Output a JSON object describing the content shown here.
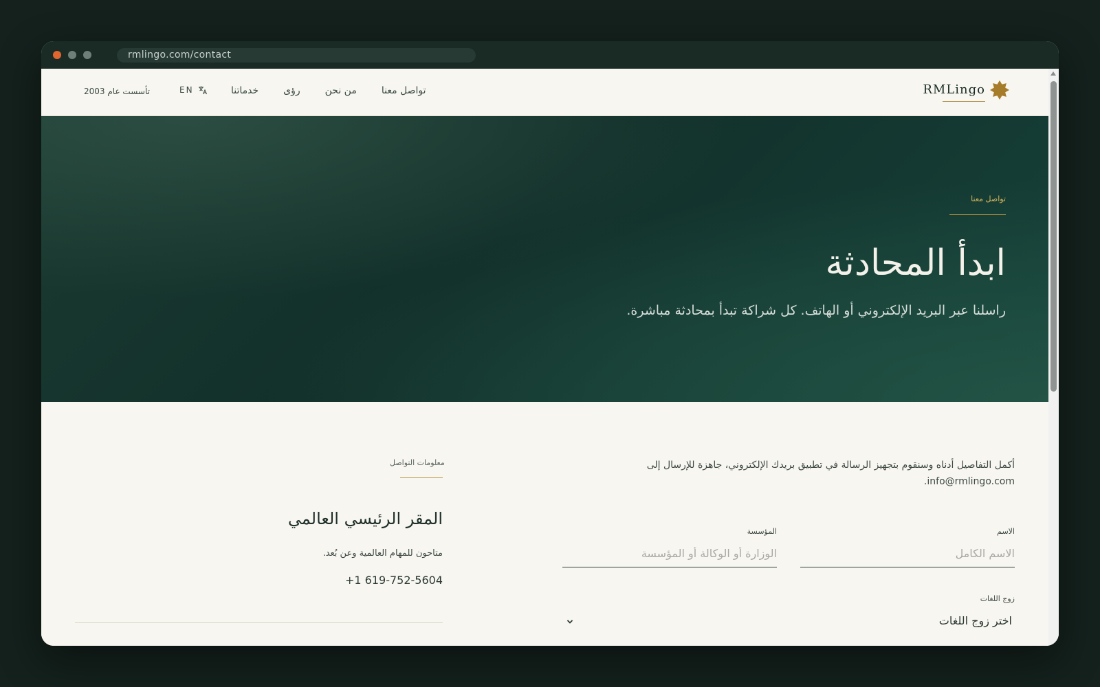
{
  "browser": {
    "url": "rmlingo.com/contact"
  },
  "nav": {
    "logo_text": "RMLingo",
    "links": [
      "خدماتنا",
      "رؤى",
      "من نحن",
      "تواصل معنا"
    ],
    "lang_label": "EN",
    "founded": "تأسست عام 2003"
  },
  "hero": {
    "eyebrow": "تواصل معنا",
    "title": "ابدأ المحادثة",
    "subtitle": "راسلنا عبر البريد الإلكتروني أو الهاتف. كل شراكة تبدأ بمحادثة مباشرة."
  },
  "form": {
    "intro": "أكمل التفاصيل أدناه وسنقوم بتجهيز الرسالة في تطبيق بريدك الإلكتروني، جاهزة للإرسال إلى info@rmlingo.com.",
    "name_label": "الاسم",
    "name_placeholder": "الاسم الكامل",
    "org_label": "المؤسسة",
    "org_placeholder": "الوزارة أو الوكالة أو المؤسسة",
    "pair_label": "زوج اللغات",
    "pair_value": "اختر زوج اللغات"
  },
  "info": {
    "eyebrow": "معلومات التواصل",
    "title": "المقر الرئيسي العالمي",
    "description": "متاحون للمهام العالمية وعن بُعد.",
    "phone": "+1 619-752-5604"
  },
  "colors": {
    "accent_gold": "#a67c2a",
    "hero_green": "#12302a",
    "page_bg": "#f8f6f1"
  }
}
